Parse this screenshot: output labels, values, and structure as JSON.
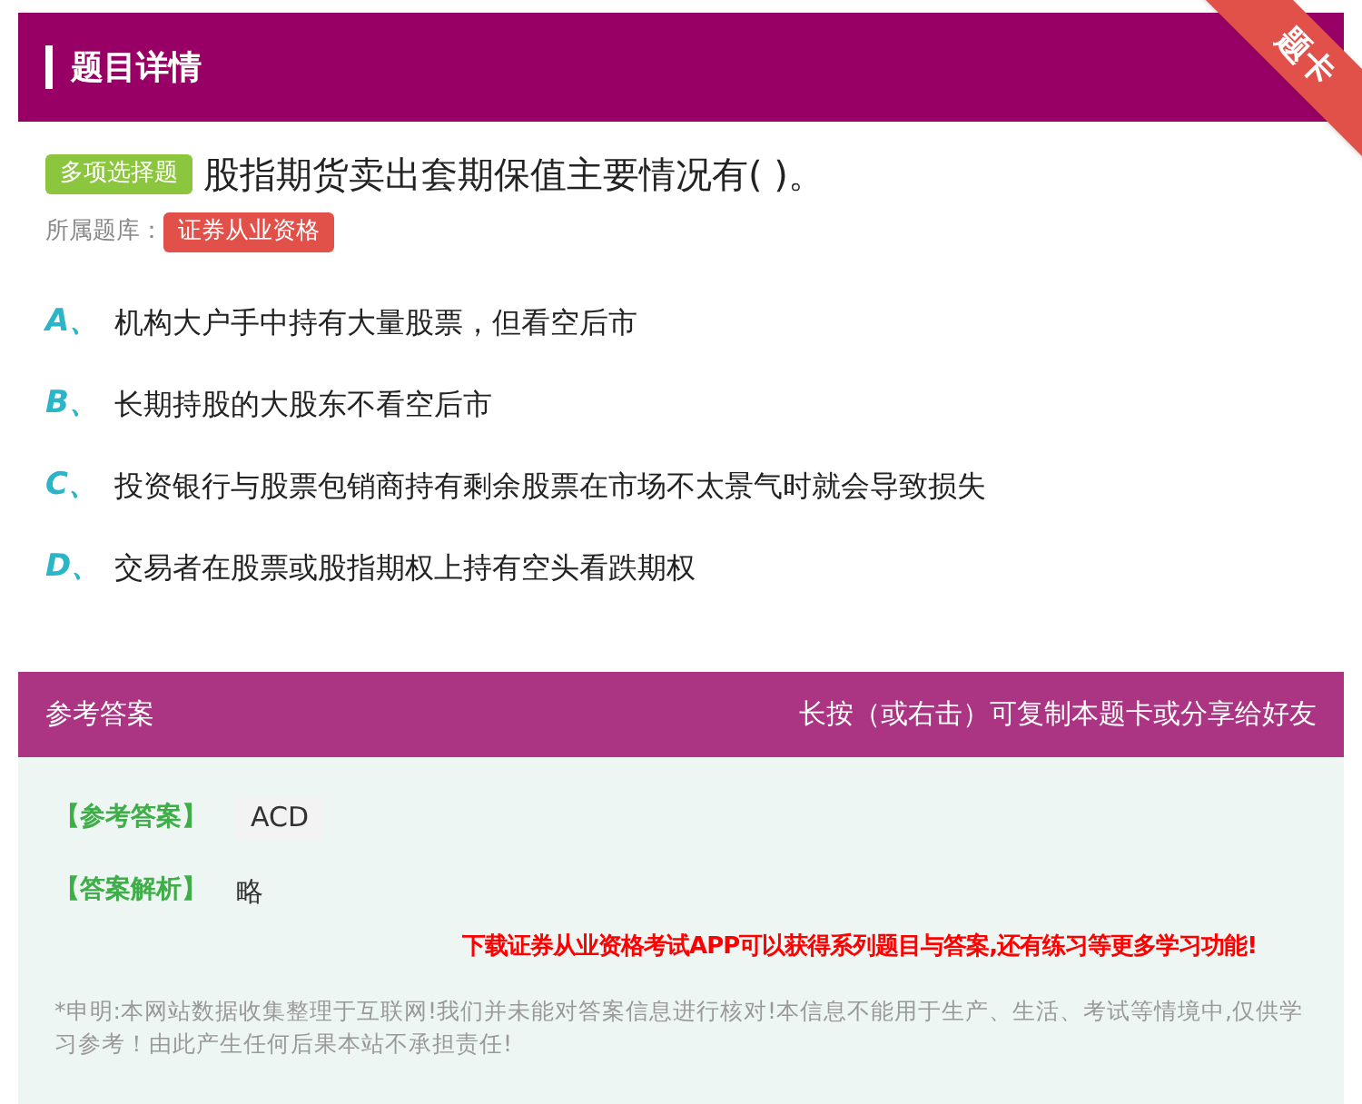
{
  "header": {
    "title": "题目详情",
    "ribbon": "题卡"
  },
  "question": {
    "type_badge": "多项选择题",
    "text": "股指期货卖出套期保值主要情况有( )。",
    "bank_label": "所属题库：",
    "bank": "证券从业资格"
  },
  "options": [
    {
      "letter": "A、",
      "text": "机构大户手中持有大量股票，但看空后市"
    },
    {
      "letter": "B、",
      "text": "长期持股的大股东不看空后市"
    },
    {
      "letter": "C、",
      "text": "投资银行与股票包销商持有剩余股票在市场不太景气时就会导致损失"
    },
    {
      "letter": "D、",
      "text": "交易者在股票或股指期权上持有空头看跌期权"
    }
  ],
  "answer_section": {
    "title": "参考答案",
    "hint": "长按（或右击）可复制本题卡或分享给好友",
    "answer_label": "【参考答案】",
    "answer": "ACD",
    "analysis_label": "【答案解析】",
    "analysis": "略",
    "promo": "下载证券从业资格考试APP可以获得系列题目与答案,还有练习等更多学习功能!",
    "disclaimer": "*申明:本网站数据收集整理于互联网!我们并未能对答案信息进行核对!本信息不能用于生产、生活、考试等情境中,仅供学习参考！由此产生任何后果本站不承担责任!"
  }
}
